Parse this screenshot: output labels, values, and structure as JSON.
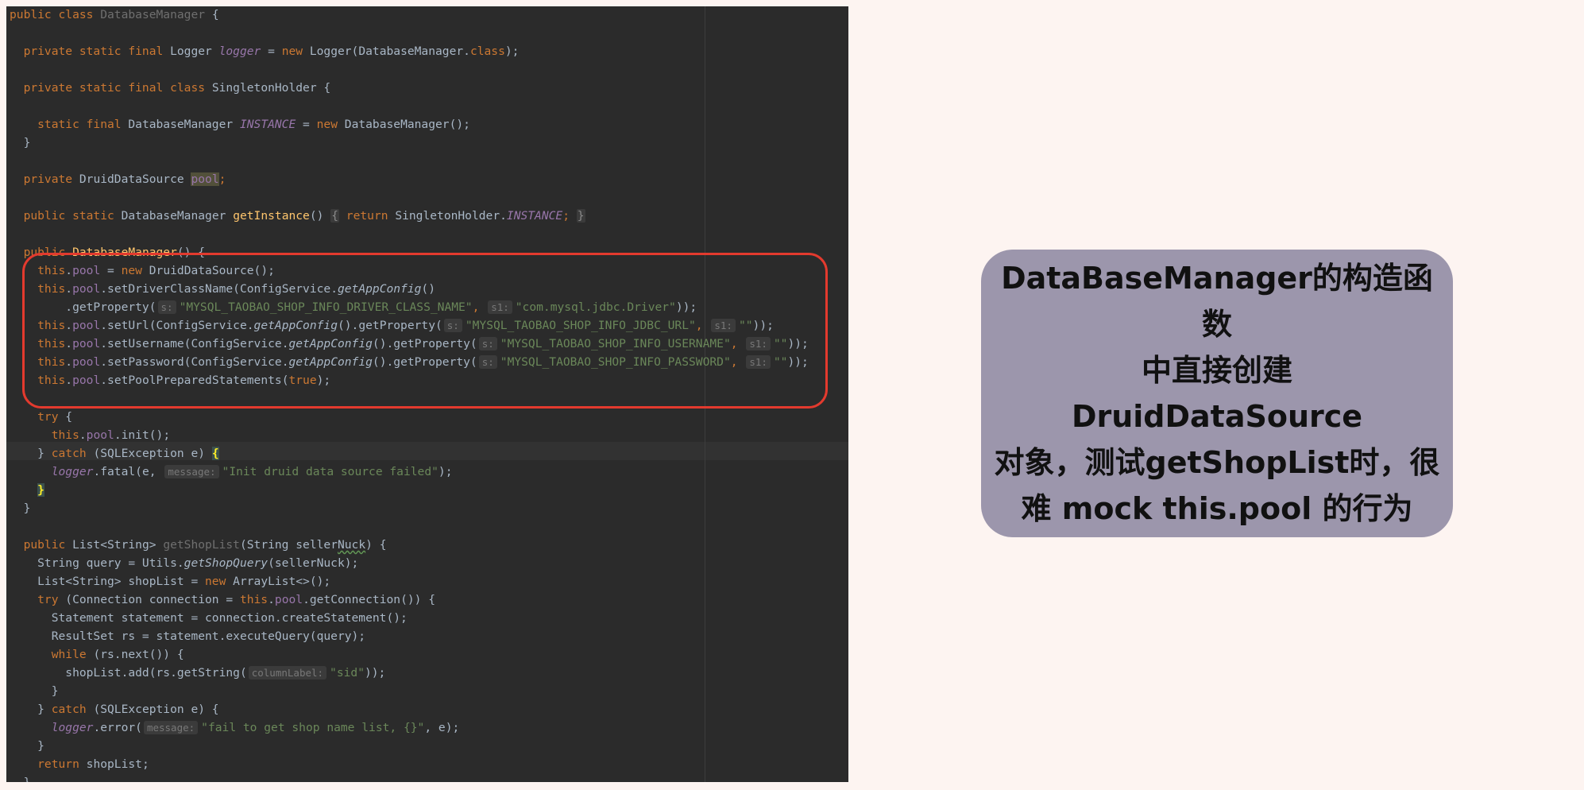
{
  "editor": {
    "lines": [
      [
        {
          "t": "public class ",
          "c": "kw"
        },
        {
          "t": "DatabaseManager",
          "c": "unused"
        },
        {
          "t": " {"
        }
      ],
      [],
      [
        {
          "t": "  private static final ",
          "c": "kw"
        },
        {
          "t": "Logger "
        },
        {
          "t": "logger",
          "c": "static-field"
        },
        {
          "t": " = "
        },
        {
          "t": "new ",
          "c": "kw"
        },
        {
          "t": "Logger(DatabaseManager."
        },
        {
          "t": "class",
          "c": "kw"
        },
        {
          "t": ");"
        }
      ],
      [],
      [
        {
          "t": "  private static final class ",
          "c": "kw"
        },
        {
          "t": "SingletonHolder {"
        }
      ],
      [],
      [
        {
          "t": "    static final ",
          "c": "kw"
        },
        {
          "t": "DatabaseManager "
        },
        {
          "t": "INSTANCE",
          "c": "static-field"
        },
        {
          "t": " = "
        },
        {
          "t": "new ",
          "c": "kw"
        },
        {
          "t": "DatabaseManager();"
        }
      ],
      [
        {
          "t": "  }"
        }
      ],
      [],
      [
        {
          "t": "  private ",
          "c": "kw"
        },
        {
          "t": "DruidDataSource "
        },
        {
          "t": "pool",
          "c": "field highlight-usage"
        },
        {
          "t": ";",
          "c": "kw"
        }
      ],
      [],
      [
        {
          "t": "  public static ",
          "c": "kw"
        },
        {
          "t": "DatabaseManager "
        },
        {
          "t": "getInstance",
          "c": "method-decl"
        },
        {
          "t": "() "
        },
        {
          "t": "{",
          "c": "fold-box"
        },
        {
          "t": " "
        },
        {
          "t": "return ",
          "c": "kw"
        },
        {
          "t": "SingletonHolder."
        },
        {
          "t": "INSTANCE",
          "c": "static-field"
        },
        {
          "t": "; ",
          "c": "kw"
        },
        {
          "t": "}",
          "c": "fold-box"
        }
      ],
      [],
      [
        {
          "t": "  public ",
          "c": "kw"
        },
        {
          "t": "DatabaseManager",
          "c": "method-decl"
        },
        {
          "t": "() {"
        }
      ],
      [
        {
          "t": "    this",
          "c": "kw"
        },
        {
          "t": "."
        },
        {
          "t": "pool",
          "c": "field"
        },
        {
          "t": " = "
        },
        {
          "t": "new ",
          "c": "kw"
        },
        {
          "t": "DruidDataSource();"
        }
      ],
      [
        {
          "t": "    this",
          "c": "kw"
        },
        {
          "t": "."
        },
        {
          "t": "pool",
          "c": "field"
        },
        {
          "t": ".setDriverClassName(ConfigService."
        },
        {
          "t": "getAppConfig",
          "c": "static-method"
        },
        {
          "t": "()"
        }
      ],
      [
        {
          "t": "        .getProperty("
        },
        {
          "t": "s:",
          "c": "hint"
        },
        {
          "t": "\"MYSQL_TAOBAO_SHOP_INFO_DRIVER_CLASS_NAME\"",
          "c": "str"
        },
        {
          "t": ", ",
          "c": "kw"
        },
        {
          "t": "s1:",
          "c": "hint"
        },
        {
          "t": "\"com.mysql.jdbc.Driver\"",
          "c": "str"
        },
        {
          "t": "));"
        }
      ],
      [
        {
          "t": "    this",
          "c": "kw"
        },
        {
          "t": "."
        },
        {
          "t": "pool",
          "c": "field"
        },
        {
          "t": ".setUrl(ConfigService."
        },
        {
          "t": "getAppConfig",
          "c": "static-method"
        },
        {
          "t": "().getProperty("
        },
        {
          "t": "s:",
          "c": "hint"
        },
        {
          "t": "\"MYSQL_TAOBAO_SHOP_INFO_JDBC_URL\"",
          "c": "str"
        },
        {
          "t": ", ",
          "c": "kw"
        },
        {
          "t": "s1:",
          "c": "hint"
        },
        {
          "t": "\"\"",
          "c": "str"
        },
        {
          "t": "));"
        }
      ],
      [
        {
          "t": "    this",
          "c": "kw"
        },
        {
          "t": "."
        },
        {
          "t": "pool",
          "c": "field"
        },
        {
          "t": ".setUsername(ConfigService."
        },
        {
          "t": "getAppConfig",
          "c": "static-method"
        },
        {
          "t": "().getProperty("
        },
        {
          "t": "s:",
          "c": "hint"
        },
        {
          "t": "\"MYSQL_TAOBAO_SHOP_INFO_USERNAME\"",
          "c": "str"
        },
        {
          "t": ", ",
          "c": "kw"
        },
        {
          "t": "s1:",
          "c": "hint"
        },
        {
          "t": "\"\"",
          "c": "str"
        },
        {
          "t": "));"
        }
      ],
      [
        {
          "t": "    this",
          "c": "kw"
        },
        {
          "t": "."
        },
        {
          "t": "pool",
          "c": "field"
        },
        {
          "t": ".setPassword(ConfigService."
        },
        {
          "t": "getAppConfig",
          "c": "static-method"
        },
        {
          "t": "().getProperty("
        },
        {
          "t": "s:",
          "c": "hint"
        },
        {
          "t": "\"MYSQL_TAOBAO_SHOP_INFO_PASSWORD\"",
          "c": "str"
        },
        {
          "t": ", ",
          "c": "kw"
        },
        {
          "t": "s1:",
          "c": "hint"
        },
        {
          "t": "\"\"",
          "c": "str"
        },
        {
          "t": "));"
        }
      ],
      [
        {
          "t": "    this",
          "c": "kw"
        },
        {
          "t": "."
        },
        {
          "t": "pool",
          "c": "field"
        },
        {
          "t": ".setPoolPreparedStatements("
        },
        {
          "t": "true",
          "c": "kw"
        },
        {
          "t": ");"
        }
      ],
      [],
      [
        {
          "t": "    try ",
          "c": "kw"
        },
        {
          "t": "{"
        }
      ],
      [
        {
          "t": "      this",
          "c": "kw"
        },
        {
          "t": "."
        },
        {
          "t": "pool",
          "c": "field"
        },
        {
          "t": ".init();"
        }
      ],
      [
        {
          "t": "    } "
        },
        {
          "t": "catch ",
          "c": "kw"
        },
        {
          "t": "(SQLException e) "
        },
        {
          "t": "{",
          "c": "brace-match"
        }
      ],
      [
        {
          "t": "      "
        },
        {
          "t": "logger",
          "c": "static-field"
        },
        {
          "t": ".fatal(e, "
        },
        {
          "t": "message:",
          "c": "hint"
        },
        {
          "t": "\"Init druid data source failed\"",
          "c": "str"
        },
        {
          "t": ");"
        }
      ],
      [
        {
          "t": "    "
        },
        {
          "t": "}",
          "c": "brace-match"
        }
      ],
      [
        {
          "t": "  }"
        }
      ],
      [],
      [
        {
          "t": "  public ",
          "c": "kw"
        },
        {
          "t": "List<String> "
        },
        {
          "t": "getShopList",
          "c": "unused"
        },
        {
          "t": "(String seller"
        },
        {
          "t": "Nuck",
          "c": "typo"
        },
        {
          "t": ") {"
        }
      ],
      [
        {
          "t": "    String query = Utils."
        },
        {
          "t": "getShopQuery",
          "c": "static-method"
        },
        {
          "t": "(sellerNuck);"
        }
      ],
      [
        {
          "t": "    List<String> shopList = "
        },
        {
          "t": "new ",
          "c": "kw"
        },
        {
          "t": "ArrayList<>();"
        }
      ],
      [
        {
          "t": "    try ",
          "c": "kw"
        },
        {
          "t": "(Connection connection = "
        },
        {
          "t": "this",
          "c": "kw"
        },
        {
          "t": "."
        },
        {
          "t": "pool",
          "c": "field"
        },
        {
          "t": ".getConnection()) {"
        }
      ],
      [
        {
          "t": "      Statement statement = connection.createStatement();"
        }
      ],
      [
        {
          "t": "      ResultSet rs = statement.executeQuery(query);"
        }
      ],
      [
        {
          "t": "      while ",
          "c": "kw"
        },
        {
          "t": "(rs.next()) {"
        }
      ],
      [
        {
          "t": "        shopList.add(rs.getString("
        },
        {
          "t": "columnLabel:",
          "c": "hint"
        },
        {
          "t": "\"sid\"",
          "c": "str"
        },
        {
          "t": "));"
        }
      ],
      [
        {
          "t": "      }"
        }
      ],
      [
        {
          "t": "    } "
        },
        {
          "t": "catch ",
          "c": "kw"
        },
        {
          "t": "(SQLException e) {"
        }
      ],
      [
        {
          "t": "      "
        },
        {
          "t": "logger",
          "c": "static-field"
        },
        {
          "t": ".error("
        },
        {
          "t": "message:",
          "c": "hint"
        },
        {
          "t": "\"fail to get shop name list, {}\"",
          "c": "str"
        },
        {
          "t": ", e);"
        }
      ],
      [
        {
          "t": "    }"
        }
      ],
      [
        {
          "t": "    return ",
          "c": "kw"
        },
        {
          "t": "shopList;"
        }
      ],
      [
        {
          "t": "  }"
        }
      ]
    ]
  },
  "annotation": {
    "lines": [
      "DataBaseManager的构造函数",
      "中直接创建 DruidDataSource",
      "对象，测试getShopList时，很",
      "难 mock this.pool 的行为"
    ]
  },
  "colors": {
    "editor_background": "#2b2b2b",
    "callout_border": "#e33a2e",
    "note_background": "#9c96ac",
    "page_background": "#fdf4f1"
  }
}
